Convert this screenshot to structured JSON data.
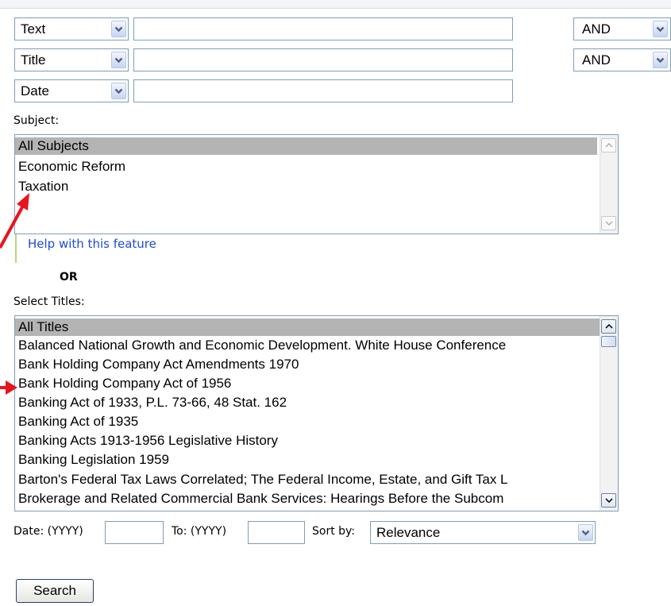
{
  "query_rows": [
    {
      "field": "Text",
      "operator": "AND"
    },
    {
      "field": "Title",
      "operator": "AND"
    },
    {
      "field": "Date"
    }
  ],
  "subject": {
    "label": "Subject:",
    "options": [
      "All Subjects",
      "Economic Reform",
      "Taxation"
    ],
    "selected": "All Subjects",
    "help_link": "Help with this feature"
  },
  "or_label": "OR",
  "titles": {
    "label": "Select Titles:",
    "options": [
      "All Titles",
      "Balanced National Growth and Economic Development. White House Conference",
      "Bank Holding Company Act Amendments 1970",
      "Bank Holding Company Act of 1956",
      "Banking Act of 1933, P.L. 73-66, 48 Stat. 162",
      "Banking Act of 1935",
      "Banking Acts 1913-1956 Legislative History",
      "Banking Legislation 1959",
      "Barton's Federal Tax Laws Correlated; The Federal Income, Estate, and Gift Tax L",
      "Brokerage and Related Commercial Bank Services: Hearings Before the Subcom"
    ],
    "selected": "All Titles"
  },
  "date_range": {
    "from_label": "Date: (YYYY)",
    "to_label": "To: (YYYY)",
    "sort_label": "Sort by:",
    "sort_value": "Relevance"
  },
  "search_button": "Search",
  "annotation_color": "#e8141c"
}
